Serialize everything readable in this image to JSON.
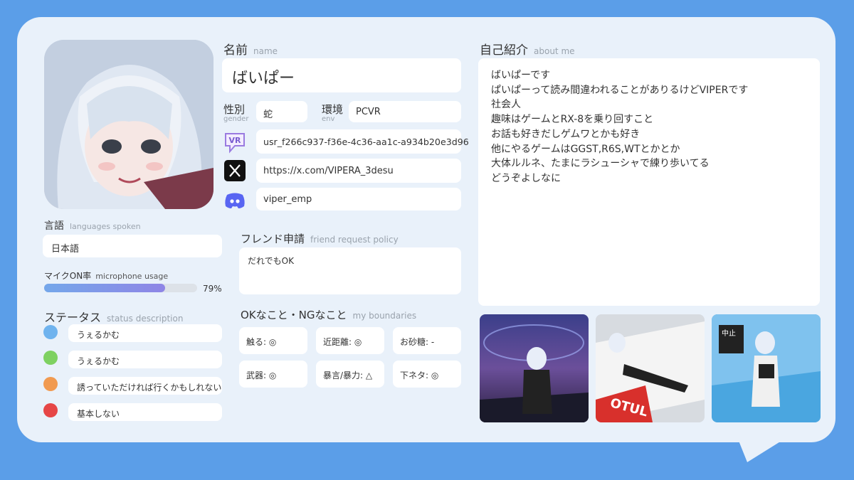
{
  "name": {
    "title": "名前",
    "sub": "name",
    "value": "ばいぱー"
  },
  "gender": {
    "title": "性別",
    "sub": "gender",
    "value": "蛇"
  },
  "env": {
    "title": "環境",
    "sub": "env",
    "value": "PCVR"
  },
  "vrchat_id": "usr_f266c937-f36e-4c36-aa1c-a934b20e3d96",
  "x_url": "https://x.com/VIPERA_3desu",
  "discord": "viper_emp",
  "language": {
    "title": "言語",
    "sub": "languages spoken",
    "value": "日本語"
  },
  "mic": {
    "title": "マイクON率",
    "sub": "microphone usage",
    "percent_label": "79%",
    "percent": 79
  },
  "status": {
    "title": "ステータス",
    "sub": "status description",
    "items": [
      {
        "color": "#6fb3ee",
        "text": "うぇるかむ"
      },
      {
        "color": "#7ed161",
        "text": "うぇるかむ"
      },
      {
        "color": "#f19a50",
        "text": "誘っていただければ行くかもしれない"
      },
      {
        "color": "#e64646",
        "text": "基本しない"
      }
    ]
  },
  "friend": {
    "title": "フレンド申請",
    "sub": "friend request policy",
    "value": "だれでもOK"
  },
  "boundaries": {
    "title": "OKなこと・NGなこと",
    "sub": "my boundaries",
    "items": [
      "触る: ◎",
      "近距離: ◎",
      "お砂糖: -",
      "武器: ◎",
      "暴言/暴力: △",
      "下ネタ: ◎"
    ]
  },
  "about": {
    "title": "自己紹介",
    "sub": "about me",
    "lines": [
      "ばいぱーです",
      "ぱいぱーって読み間違われることがありるけどVIPERです",
      "社会人",
      "趣味はゲームとRX-8を乗り回すこと",
      "お話も好きだしゲムワとかも好き",
      "他にやるゲームはGGST,R6S,WTとかとか",
      "大体ルルネ、たまにラシューシャで練り歩いてる",
      "どうぞよしなに"
    ]
  },
  "icons": {
    "vrchat": "vrchat-icon",
    "x": "x-logo-icon",
    "discord": "discord-icon"
  },
  "colors": {
    "background": "#5b9ee8",
    "card": "#e9f1fa",
    "accent": "#8f85e6"
  }
}
